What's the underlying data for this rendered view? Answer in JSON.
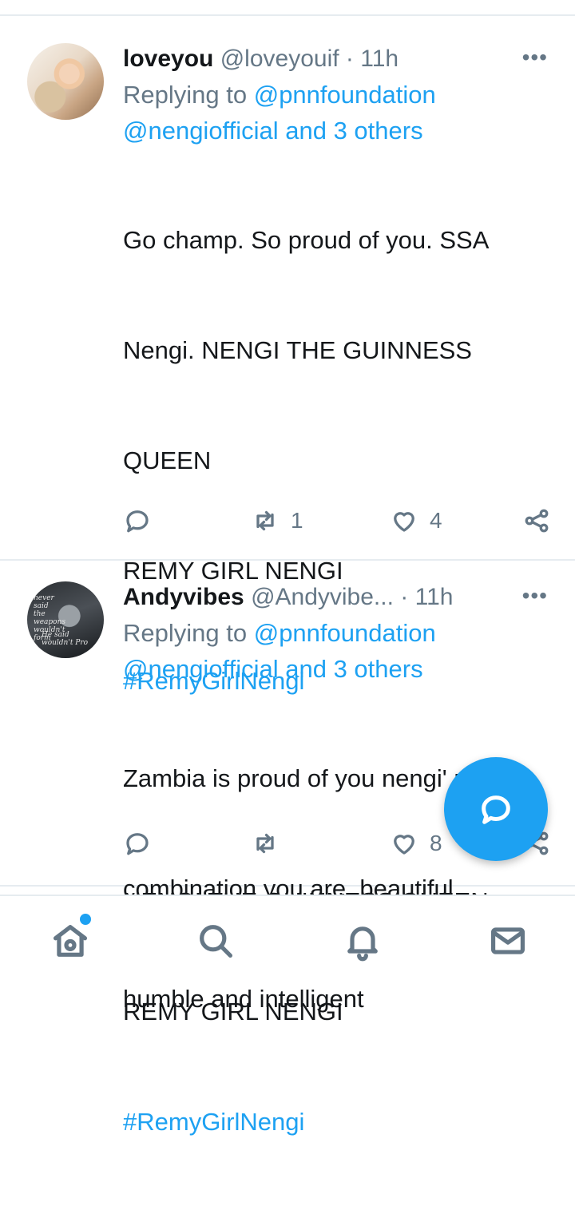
{
  "theme": {
    "accent": "#1da1f2",
    "muted": "#657786",
    "text": "#14171a",
    "divider": "#e6ecf0"
  },
  "tweets": [
    {
      "name": "loveyou",
      "handle": "@loveyouif",
      "separator": "·",
      "time": "11h",
      "more_icon": "more-horizontal-icon",
      "replying_prefix": "Replying to",
      "replying_to": "@pnnfoundation",
      "replying_more": "@nengiofficial and 3 others",
      "lines": [
        "Go champ. So proud of you. SSA",
        "Nengi. NENGI THE GUINNESS",
        "QUEEN",
        "REMY GIRL NENGI"
      ],
      "hashtag_1": "#RemyGirlNengi",
      "lines_2": [
        "NENGI THE GUINNESS QUEEN",
        "REMY GIRL NENGI"
      ],
      "hashtag_2": "#RemyGirlNengi",
      "reply_count": "",
      "retweet_count": "1",
      "like_count": "4"
    },
    {
      "name": "Andyvibes",
      "handle": "@Andyvibe...",
      "separator": "·",
      "time": "11h",
      "more_icon": "more-horizontal-icon",
      "replying_prefix": "Replying to",
      "replying_to": "@pnnfoundation",
      "replying_more": "@nengiofficial and 3 others",
      "lines": [
        "Zambia is proud of you nengi' rear",
        "combination you are, beautiful",
        "humble and intelligent"
      ],
      "avatar_text": {
        "top": "never said the weapons wouldn't form",
        "bottom": "He said wouldn't Pro"
      },
      "retweet_count": "",
      "like_count": "8"
    }
  ],
  "fab": {
    "icon": "compose-reply-icon"
  },
  "bottom_nav": [
    {
      "icon": "home-icon",
      "has_dot": true
    },
    {
      "icon": "search-icon"
    },
    {
      "icon": "notifications-bell-icon"
    },
    {
      "icon": "messages-envelope-icon"
    }
  ]
}
